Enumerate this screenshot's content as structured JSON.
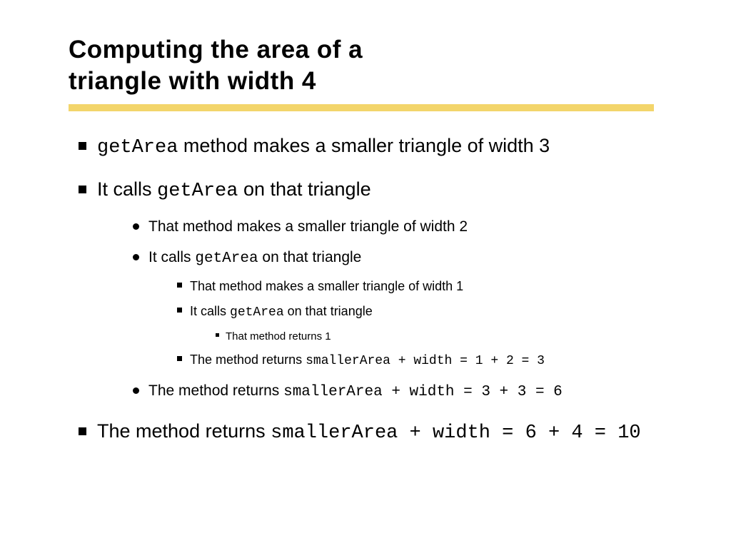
{
  "title_line1": "Computing the area of a",
  "title_line2": "triangle with width 4",
  "b1_a": "getArea",
  "b1_b": " method makes a smaller triangle of width 3",
  "b2_a": "It calls ",
  "b2_b": "getArea",
  "b2_c": " on that triangle",
  "b2_1": "That method makes a smaller triangle of width 2",
  "b2_2_a": "It calls ",
  "b2_2_b": "getArea",
  "b2_2_c": " on that triangle",
  "b2_2_1": "That method makes a smaller triangle of width 1",
  "b2_2_2_a": "It calls ",
  "b2_2_2_b": "getArea",
  "b2_2_2_c": " on that triangle",
  "b2_2_2_1": "That method returns 1",
  "b2_2_3_a": "The method returns ",
  "b2_2_3_b": "smallerArea + width = 1 + 2 = 3",
  "b2_3_a": "The method returns ",
  "b2_3_b": "smallerArea + width = 3 + 3 = 6",
  "b3_a": "The method returns ",
  "b3_b": "smallerArea + width = 6 + 4 = 10"
}
